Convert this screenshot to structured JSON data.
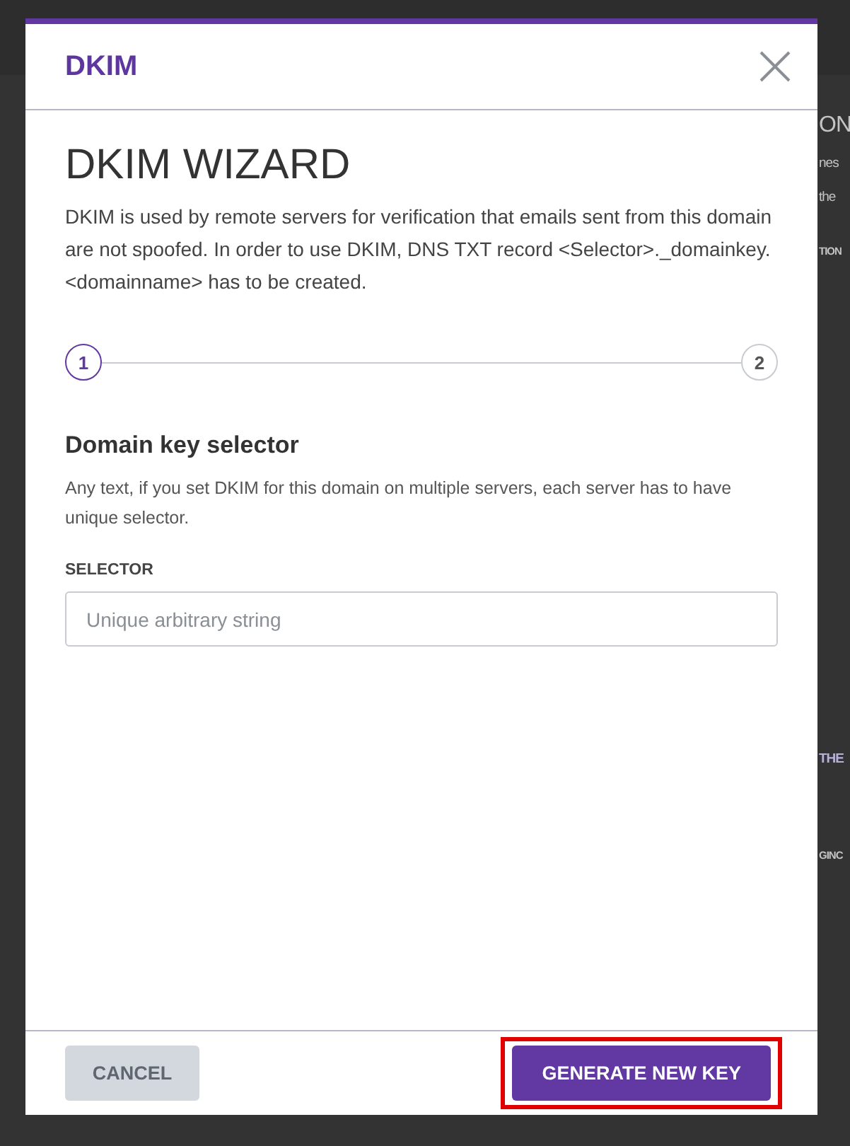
{
  "background_fragments": [
    {
      "text": "ON",
      "kind": "heading"
    },
    {
      "text": "nes",
      "kind": "text"
    },
    {
      "text": "the",
      "kind": "text"
    },
    {
      "text": "TION",
      "kind": "label"
    },
    {
      "text": "THE",
      "kind": "link"
    },
    {
      "text": "GINC",
      "kind": "label"
    }
  ],
  "dialog": {
    "title": "DKIM",
    "heading": "DKIM WIZARD",
    "description": "DKIM is used by remote servers for verification that emails sent from this domain are not spoofed. In order to use DKIM, DNS TXT record <Selector>._domainkey.<domainname> has to be created.",
    "steps": [
      {
        "label": "1",
        "selected": true
      },
      {
        "label": "2",
        "selected": false
      }
    ],
    "section_title": "Domain key selector",
    "section_help": "Any text, if you set DKIM for this domain on multiple servers, each server has to have unique selector.",
    "field": {
      "label": "SELECTOR",
      "placeholder": "Unique arbitrary string"
    },
    "buttons": [
      {
        "label": "CANCEL",
        "kind": "secondary",
        "disabled": true,
        "highlighted": false
      },
      {
        "label": "GENERATE NEW KEY",
        "kind": "primary",
        "disabled": false,
        "highlighted": true
      }
    ]
  }
}
